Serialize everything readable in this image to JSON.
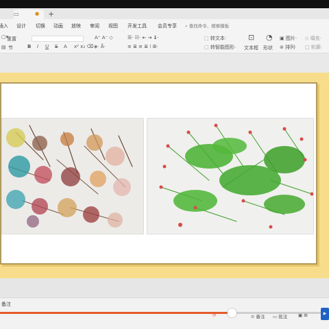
{
  "window": {
    "tab_icon": "▭",
    "tab_dot": "●",
    "new_tab": "+"
  },
  "menubar": {
    "items": [
      "插入",
      "设计",
      "切换",
      "动画",
      "放映",
      "审阅",
      "视图",
      "开发工具",
      "会员专享"
    ],
    "search_placeholder": "查找命令、搜索模板"
  },
  "ribbon": {
    "reset": "重置",
    "section": "节",
    "bold": "B",
    "italic": "I",
    "underline": "U",
    "strike": "S",
    "font_color": "A",
    "convert_art": "转文本",
    "convert_smart": "转智能图形",
    "textbox": "文本框",
    "shape": "形状",
    "picture": "图片",
    "arrange": "排列",
    "fill": "填充",
    "outline": "轮廓"
  },
  "status": {
    "notes": "备注",
    "view_notes": "备注",
    "view_comment": "批注"
  },
  "accent": "#e55a2b",
  "slide_border": "#b19a5c",
  "slide_bg": "#f7dd8b",
  "playback": {
    "progress": 0.7
  },
  "photos": [
    {
      "name": "colorful-ink-blow-painting"
    },
    {
      "name": "green-ink-blow-painting-with-red-dots"
    }
  ]
}
